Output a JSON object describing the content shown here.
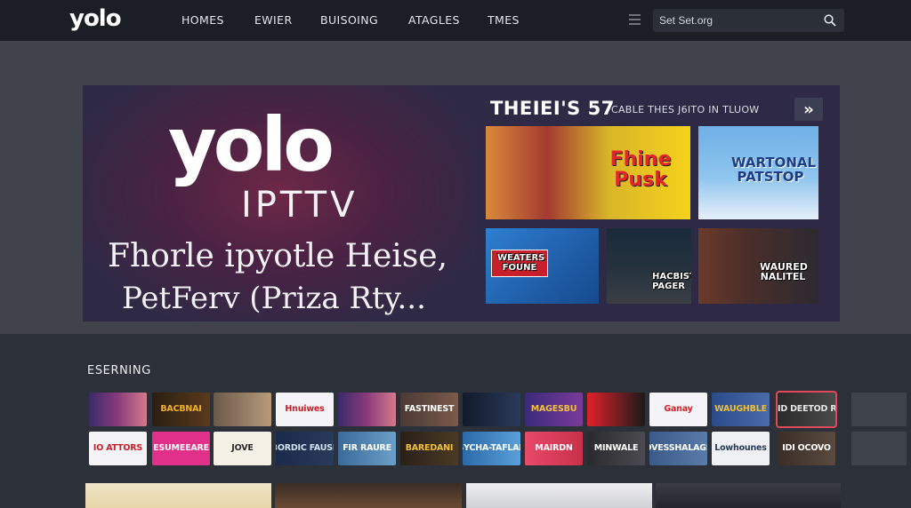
{
  "nav": {
    "logo": "yolo",
    "links": [
      "HOMES",
      "EWIER",
      "BUISOING",
      "ATAGLES",
      "TMES"
    ],
    "search_value": "Set Set.org",
    "menu_icon": "list-icon",
    "search_icon": "search-icon"
  },
  "hero": {
    "word": "yolo",
    "sub": "IPTTV",
    "tagline1": "Fhorle ipyotle Heise,",
    "tagline2": "PetFerv (Priza Rty...",
    "heading": "THEIEI'S 57",
    "caption": "CABLE THES J6ITO IN TLUOW",
    "next_label": "»",
    "features": [
      "Fhine Pusk",
      "WARTONAL PATSTOP",
      "WEATERS FOUNE",
      "HACBIST PAGER",
      "WAURED NALITEL"
    ]
  },
  "row": {
    "title": "ESERNING",
    "tiles_top": [
      "",
      "BACBNAI",
      "",
      "Hnuiwes",
      "",
      "FASTINEST",
      "",
      "MAGESBU",
      "",
      "Ganay",
      "WAUGHBLE",
      "WRIOID DEETOD RVERS",
      ""
    ],
    "tiles_bottom": [
      "IO ATTORS",
      "ESUMEEARE",
      "JOVE",
      "BORDIC FAUSE",
      "FIR RAURE",
      "BAREDANI",
      "SYCHA-TAFLAR",
      "MAIRDN",
      "MINWALE",
      "OVESSHALAGS",
      "Lowhounes",
      "IDI OCOVO",
      ""
    ]
  },
  "colors": {
    "nav_bg": "#1b1e25",
    "hero_bg": "#2e2a45",
    "accent_selected": "#e0495a"
  }
}
